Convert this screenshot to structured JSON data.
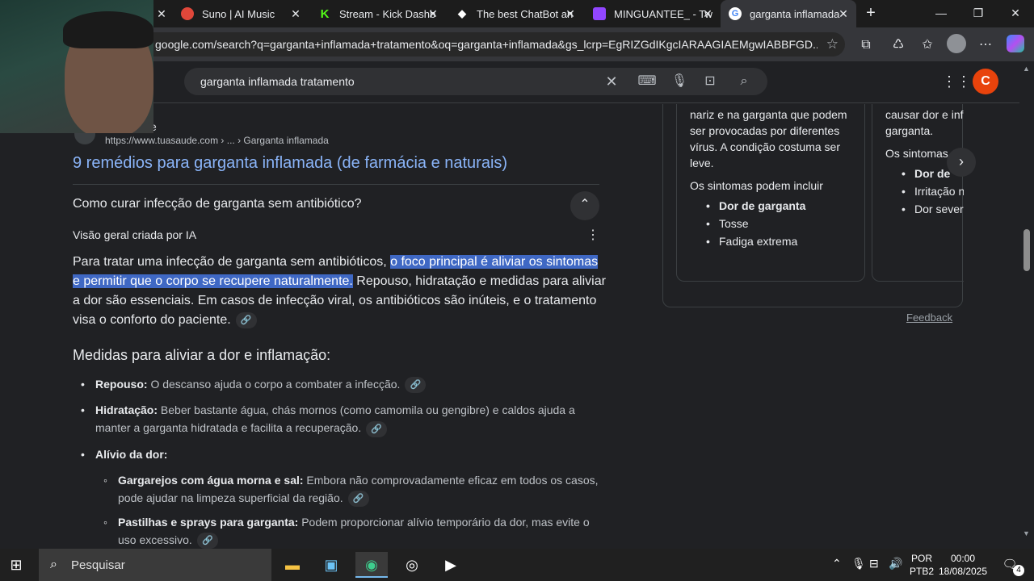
{
  "browser": {
    "tabs": [
      {
        "label": "Suno | AI Music",
        "icon": "suno-icon",
        "color": "#e0473a"
      },
      {
        "label": "Stream - Kick Dashb",
        "icon": "kick-icon",
        "color": "#53fc18"
      },
      {
        "label": "The best ChatBot an",
        "icon": "chatbot-icon",
        "color": "#ffffff"
      },
      {
        "label": "MINGUANTEE_ - Twi",
        "icon": "twitch-icon",
        "color": "#9146ff"
      },
      {
        "label": "garganta inflamada",
        "icon": "google-icon",
        "color": "#4285f4"
      }
    ],
    "url": "google.com/search?q=garganta+inflamada+tratamento&oq=garganta+inflamada&gs_lcrp=EgRIZGdIKgcIARAAGIAEMgwIABBFGD..."
  },
  "google": {
    "query": "garganta inflamada tratamento",
    "avatar_letter": "C",
    "avatar_color": "#e8430c"
  },
  "result": {
    "source_name": "e",
    "source_url": "https://www.tuasaude.com › ... › Garganta inflamada",
    "title": "9 remédios para garganta inflamada (de farmácia e naturais)"
  },
  "ai_overview": {
    "question": "Como curar infecção de garganta sem antibiótico?",
    "label": "Visão geral criada por IA",
    "para_before": "Para tratar uma infecção de garganta sem antibióticos, ",
    "para_highlight": "o foco principal é aliviar os sintomas e permitir que o corpo se recupere naturalmente.",
    "para_after": " Repouso, hidratação e medidas para aliviar a dor são essenciais. Em casos de infecção viral, os antibióticos são inúteis, e o tratamento visa o conforto do paciente.",
    "section_title": "Medidas para aliviar a dor e inflamação:",
    "items": [
      {
        "title": "Repouso:",
        "text": " O descanso ajuda o corpo a combater a infecção."
      },
      {
        "title": "Hidratação:",
        "text": " Beber bastante água, chás mornos (como camomila ou gengibre) e caldos ajuda a manter a garganta hidratada e facilita a recuperação."
      },
      {
        "title": "Alívio da dor:",
        "text": ""
      }
    ],
    "subitems": [
      {
        "title": "Gargarejos com água morna e sal:",
        "text": " Embora não comprovadamente eficaz em todos os casos, pode ajudar na limpeza superficial da região."
      },
      {
        "title": "Pastilhas e sprays para garganta:",
        "text": " Podem proporcionar alívio temporário da dor, mas evite o uso excessivo."
      }
    ]
  },
  "side_panel": {
    "card1": {
      "text": "nariz e na garganta que podem ser provocadas por diferentes vírus. A condição costuma ser leve.",
      "symptoms_intro": "Os sintomas podem incluir",
      "symptoms": [
        "Dor de garganta",
        "Tosse",
        "Fadiga extrema"
      ]
    },
    "card2": {
      "text": "causar dor e inf garganta.",
      "symptoms_intro": "Os sintomas po",
      "symptoms": [
        "Dor de",
        "Irritação n",
        "Dor sever"
      ]
    },
    "feedback": "Feedback"
  },
  "taskbar": {
    "search_placeholder": "Pesquisar",
    "lang_line1": "POR",
    "lang_line2": "PTB2",
    "time": "00:00",
    "date": "18/08/2025",
    "notifications": "4"
  }
}
